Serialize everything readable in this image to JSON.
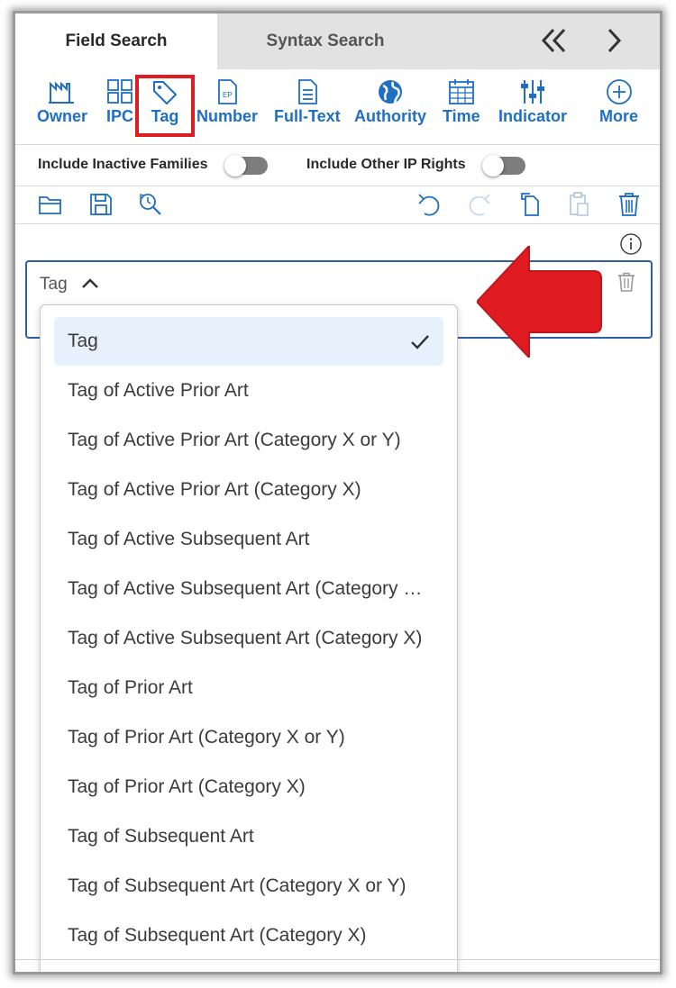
{
  "tabs": {
    "field_search": "Field Search",
    "syntax_search": "Syntax Search"
  },
  "toolbar": {
    "items": [
      {
        "label": "Owner",
        "icon": "factory-icon"
      },
      {
        "label": "IPC",
        "icon": "grid-icon"
      },
      {
        "label": "Tag",
        "icon": "tag-icon"
      },
      {
        "label": "Number",
        "icon": "ep-document-icon"
      },
      {
        "label": "Full-Text",
        "icon": "document-icon"
      },
      {
        "label": "Authority",
        "icon": "globe-icon"
      },
      {
        "label": "Time",
        "icon": "calendar-icon"
      },
      {
        "label": "Indicator",
        "icon": "sliders-icon"
      },
      {
        "label": "More",
        "icon": "plus-circle-icon"
      }
    ]
  },
  "toggles": {
    "inactive_families": {
      "label": "Include Inactive Families",
      "on": false
    },
    "other_ip_rights": {
      "label": "Include Other IP Rights",
      "on": false
    }
  },
  "field": {
    "label": "Tag"
  },
  "dropdown": {
    "selected_index": 0,
    "options": [
      "Tag",
      "Tag of Active Prior Art",
      "Tag of Active Prior Art (Category X or Y)",
      "Tag of Active Prior Art (Category X)",
      "Tag of Active Subsequent Art",
      "Tag of Active Subsequent Art (Category X or Y)",
      "Tag of Active Subsequent Art (Category X)",
      "Tag of Prior Art",
      "Tag of Prior Art (Category X or Y)",
      "Tag of Prior Art (Category X)",
      "Tag of Subsequent Art",
      "Tag of Subsequent Art (Category X or Y)",
      "Tag of Subsequent Art (Category X)"
    ]
  },
  "colors": {
    "accent_blue": "#1f6fc4",
    "highlight_red": "#e01b22",
    "selected_bg": "#e6f1fc",
    "toggle_off": "#7d7d7d"
  }
}
